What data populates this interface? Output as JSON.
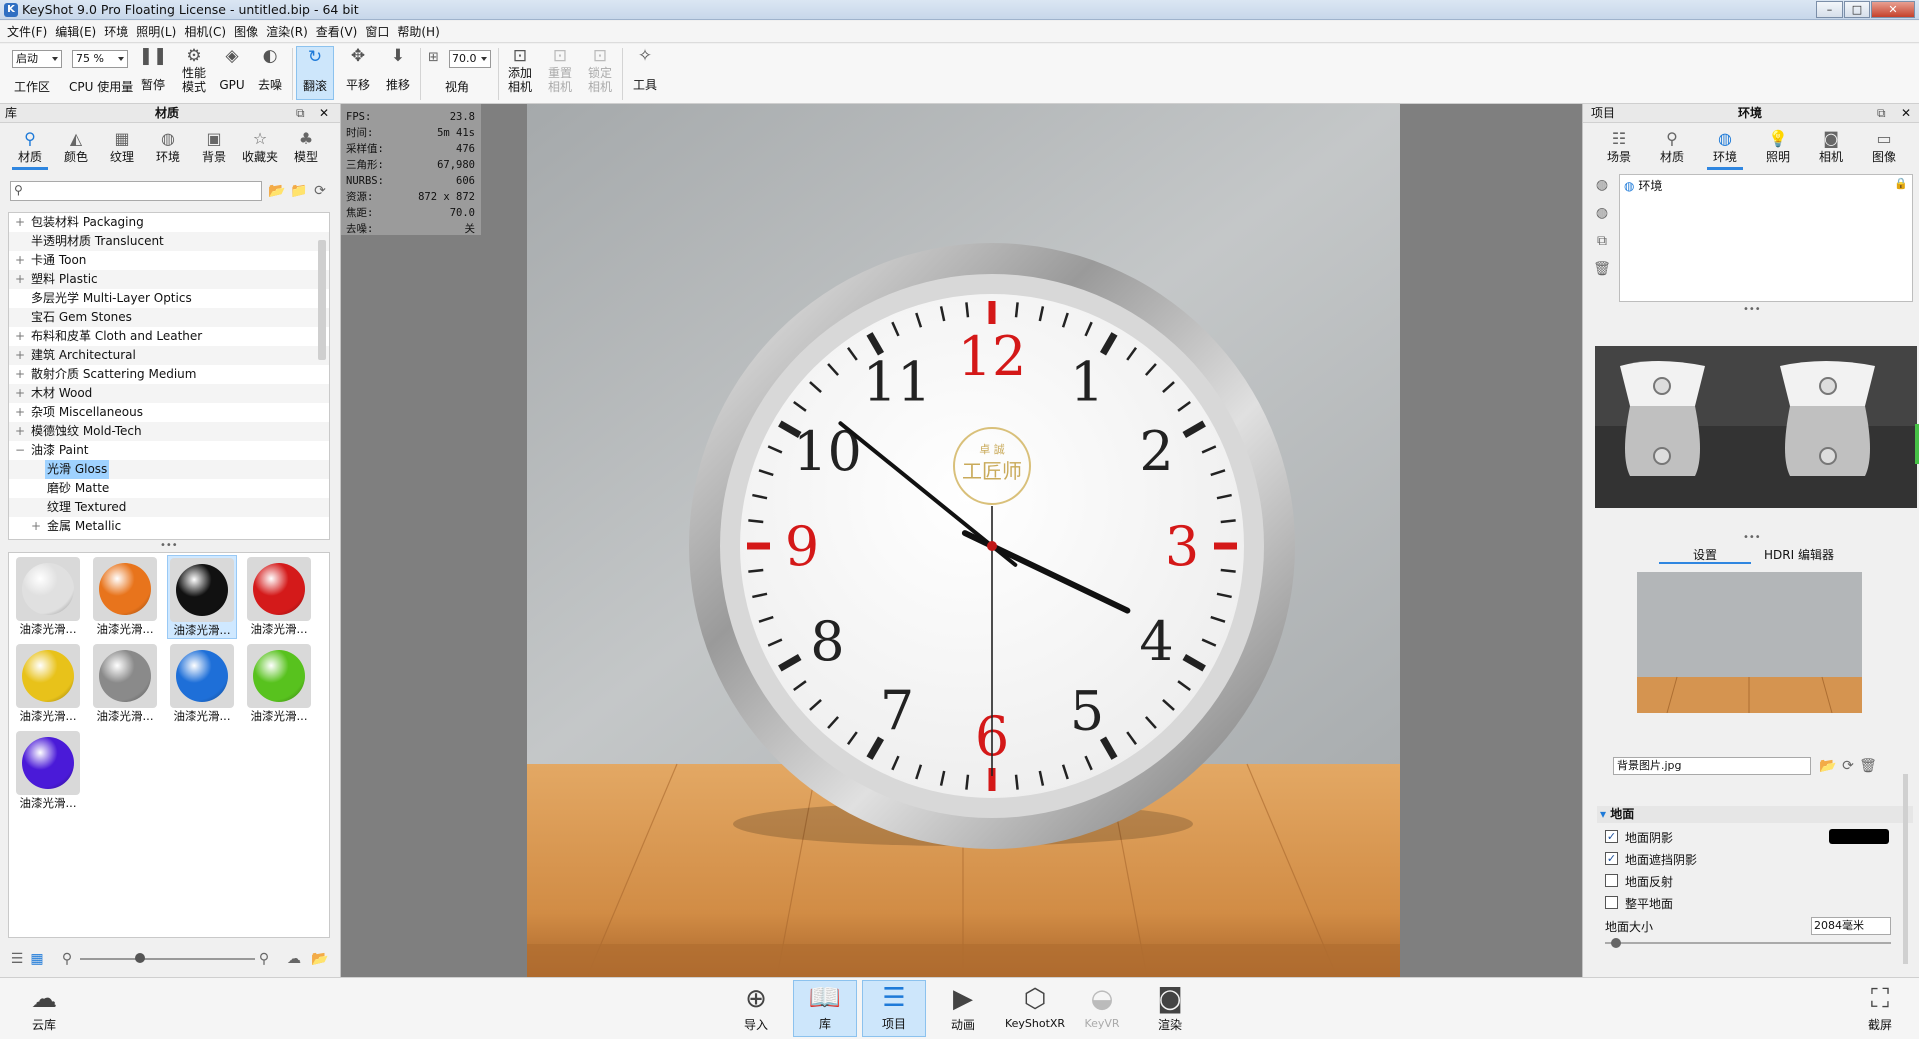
{
  "window": {
    "title": "KeyShot 9.0 Pro Floating License - untitled.bip - 64 bit",
    "app_icon": "K",
    "min": "–",
    "max": "□",
    "close": "✕"
  },
  "menu": [
    "文件(F)",
    "编辑(E)",
    "环境",
    "照明(L)",
    "相机(C)",
    "图像",
    "渲染(R)",
    "查看(V)",
    "窗口",
    "帮助(H)"
  ],
  "toolbar": {
    "workspace_value": "启动",
    "workspace_label": "工作区",
    "cpu_value": "75 %",
    "cpu_label": "CPU 使用量",
    "pause": "暂停",
    "perf_l1": "性能",
    "perf_l2": "模式",
    "gpu": "GPU",
    "denoise": "去噪",
    "tumble": "翻滚",
    "pan": "平移",
    "dolly": "推移",
    "fov_value": "70.0",
    "fov_label": "视角",
    "add_cam_l1": "添加",
    "add_cam_l2": "相机",
    "reset_cam_l1": "重置",
    "reset_cam_l2": "相机",
    "lock_cam_l1": "锁定",
    "lock_cam_l2": "相机",
    "tools": "工具"
  },
  "library": {
    "panel_label": "库",
    "title": "材质",
    "tabs": [
      "材质",
      "颜色",
      "纹理",
      "环境",
      "背景",
      "收藏夹",
      "模型"
    ],
    "search_placeholder": "",
    "tree": [
      {
        "label": "包装材料 Packaging",
        "expander": "+",
        "level": 0
      },
      {
        "label": "半透明材质 Translucent",
        "expander": "",
        "level": 0
      },
      {
        "label": "卡通 Toon",
        "expander": "+",
        "level": 0
      },
      {
        "label": "塑料 Plastic",
        "expander": "+",
        "level": 0
      },
      {
        "label": "多层光学 Multi-Layer Optics",
        "expander": "",
        "level": 0
      },
      {
        "label": "宝石 Gem Stones",
        "expander": "",
        "level": 0
      },
      {
        "label": "布料和皮革 Cloth and Leather",
        "expander": "+",
        "level": 0
      },
      {
        "label": "建筑 Architectural",
        "expander": "+",
        "level": 0
      },
      {
        "label": "散射介质 Scattering Medium",
        "expander": "+",
        "level": 0
      },
      {
        "label": "木材 Wood",
        "expander": "+",
        "level": 0
      },
      {
        "label": "杂项 Miscellaneous",
        "expander": "+",
        "level": 0
      },
      {
        "label": "模德蚀纹 Mold-Tech",
        "expander": "+",
        "level": 0
      },
      {
        "label": "油漆 Paint",
        "expander": "−",
        "level": 0
      },
      {
        "label": "光滑 Gloss",
        "expander": "",
        "level": 1,
        "selected": true
      },
      {
        "label": "磨砂 Matte",
        "expander": "",
        "level": 1
      },
      {
        "label": "纹理 Textured",
        "expander": "",
        "level": 1
      },
      {
        "label": "金属 Metallic",
        "expander": "+",
        "level": 1
      }
    ],
    "materials": [
      {
        "label": "油漆光滑...",
        "color": "#e0e0e0"
      },
      {
        "label": "油漆光滑...",
        "color": "#e8741c"
      },
      {
        "label": "油漆光滑...",
        "color": "#111111",
        "selected": true
      },
      {
        "label": "油漆光滑...",
        "color": "#d41a1a"
      },
      {
        "label": "油漆光滑...",
        "color": "#e8c21a"
      },
      {
        "label": "油漆光滑...",
        "color": "#8a8a8a"
      },
      {
        "label": "油漆光滑...",
        "color": "#1e6fd8"
      },
      {
        "label": "油漆光滑...",
        "color": "#58c21e"
      },
      {
        "label": "油漆光滑...",
        "color": "#4a1ad8"
      }
    ]
  },
  "stats": [
    {
      "k": "FPS:",
      "v": "23.8"
    },
    {
      "k": "时间:",
      "v": "5m 41s"
    },
    {
      "k": "采样值:",
      "v": "476"
    },
    {
      "k": "三角形:",
      "v": "67,980"
    },
    {
      "k": "NURBS:",
      "v": "606"
    },
    {
      "k": "资源:",
      "v": "872 x 872"
    },
    {
      "k": "焦距:",
      "v": "70.0"
    },
    {
      "k": "去噪:",
      "v": "关"
    }
  ],
  "clock": {
    "hour_numerals": [
      "12",
      "1",
      "2",
      "3",
      "4",
      "5",
      "6",
      "7",
      "8",
      "9",
      "10",
      "11"
    ],
    "logo_line1": "卓 誠",
    "logo_line2": "工匠师",
    "time_hour": 3,
    "time_minute": 51,
    "time_second": 30
  },
  "project": {
    "panel_label": "项目",
    "title": "环境",
    "tabs": [
      "场景",
      "材质",
      "环境",
      "照明",
      "相机",
      "图像"
    ],
    "env_list": [
      {
        "label": "环境"
      }
    ],
    "subtabs": [
      "设置",
      "HDRI 编辑器"
    ],
    "background_file": "背景图片.jpg",
    "ground_section": "地面",
    "options": [
      {
        "label": "地面阴影",
        "checked": true
      },
      {
        "label": "地面遮挡阴影",
        "checked": true
      },
      {
        "label": "地面反射",
        "checked": false
      },
      {
        "label": "整平地面",
        "checked": false
      }
    ],
    "ground_shadow_color": "#000000",
    "ground_size_label": "地面大小",
    "ground_size_value": "2084毫米"
  },
  "bottom": {
    "cloud": "云库",
    "buttons": [
      "导入",
      "库",
      "项目",
      "动画",
      "KeyShotXR",
      "KeyVR",
      "渲染"
    ],
    "screenshot": "截屏"
  }
}
